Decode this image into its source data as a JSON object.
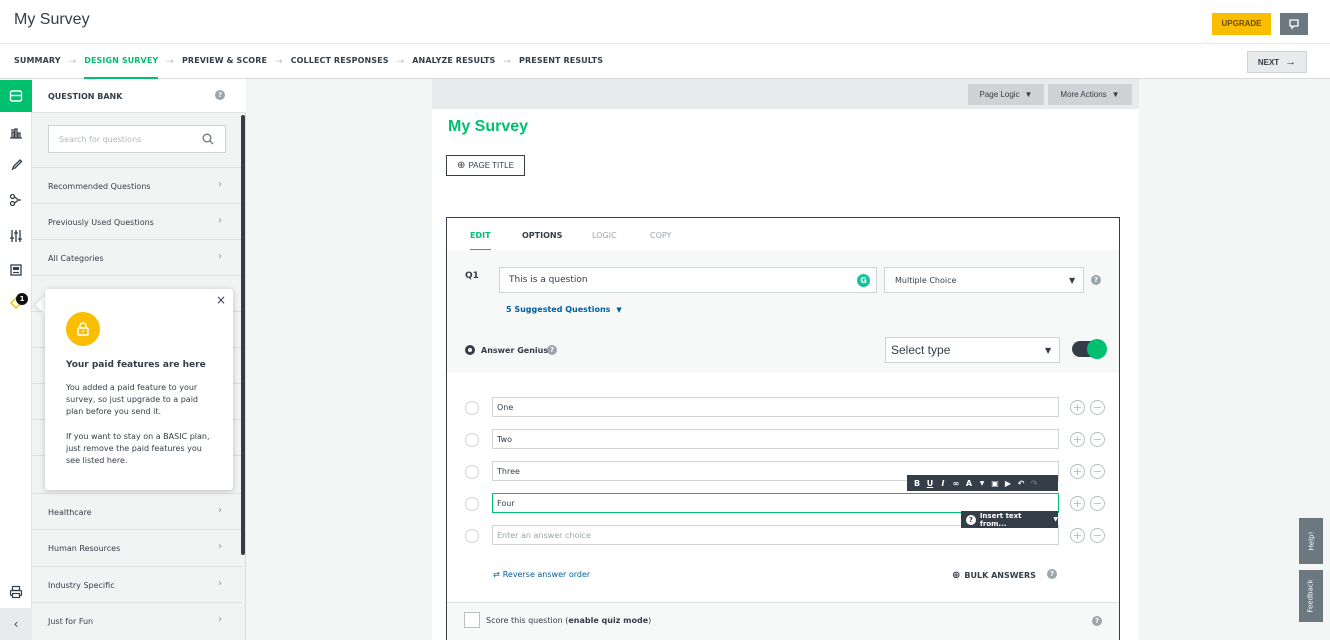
{
  "header": {
    "title": "My Survey",
    "upgrade_label": "UPGRADE"
  },
  "steps": {
    "items": [
      "SUMMARY",
      "DESIGN SURVEY",
      "PREVIEW & SCORE",
      "COLLECT RESPONSES",
      "ANALYZE RESULTS",
      "PRESENT RESULTS"
    ],
    "active": "DESIGN SURVEY",
    "next_label": "NEXT"
  },
  "rail": {
    "icons": [
      "question-bank-icon",
      "builder-icon",
      "design-icon",
      "logic-icon",
      "options-icon",
      "print-icon",
      "paid-features-icon"
    ],
    "badge_count": "1"
  },
  "question_bank": {
    "title": "QUESTION BANK",
    "search_placeholder": "Search for questions",
    "categories": [
      "Recommended Questions",
      "Previously Used Questions",
      "All Categories",
      "Healthcare",
      "Human Resources",
      "Industry Specific",
      "Just for Fun"
    ]
  },
  "popover": {
    "title": "Your paid features are here",
    "p1": "You added a paid feature to your survey, so just upgrade to a paid plan before you send it.",
    "p2": "If you want to stay on a BASIC plan, just remove the paid features you see listed here."
  },
  "page": {
    "toolbar_page_logic": "Page Logic",
    "toolbar_more_actions": "More Actions",
    "heading": "My Survey",
    "page_title_btn": "PAGE TITLE"
  },
  "question": {
    "tabs": [
      "EDIT",
      "OPTIONS",
      "LOGIC",
      "COPY"
    ],
    "number": "Q1",
    "text": "This is a question",
    "type": "Multiple Choice",
    "suggested": "5 Suggested Questions",
    "genius_label": "Answer Genius",
    "select_type": "Select type",
    "choices": [
      "One",
      "Two",
      "Three",
      "Four"
    ],
    "choice_placeholder": "Enter an answer choice",
    "insert_text": "Insert text from...",
    "reverse_order": "Reverse answer order",
    "bulk_answers": "BULK ANSWERS",
    "score_prefix": "Score this question (",
    "score_bold": "enable quiz mode",
    "score_suffix": ")"
  },
  "side_tabs": {
    "help": "Help!",
    "feedback": "Feedback"
  },
  "colors": {
    "brand_green": "#00bf6f",
    "upgrade_yellow": "#f9be00",
    "charcoal": "#333e48",
    "link_blue": "#005f9e"
  }
}
